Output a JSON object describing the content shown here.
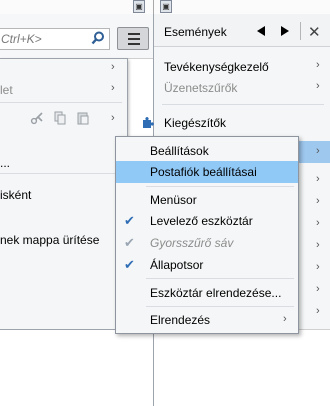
{
  "search": {
    "placeholder": "Ctrl+K>"
  },
  "right_pane": {
    "title": "Események",
    "items": [
      {
        "label": "Tevékenységkezelő",
        "dim": false
      },
      {
        "label": "Üzenetszűrők",
        "dim": true
      },
      {
        "label": "Kiegészítők",
        "dim": false
      }
    ]
  },
  "left_menu": {
    "items": [
      {
        "label": "let",
        "dim": true
      },
      {
        "label": "...",
        "dim": false
      },
      {
        "label": "isként",
        "dim": false
      },
      {
        "label": "nek mappa ürítése",
        "dim": false
      }
    ]
  },
  "submenu": {
    "items": [
      {
        "label": "Beállítások",
        "checked": false,
        "dim": false,
        "highlight": false,
        "arrow": false
      },
      {
        "label": "Postafiók beállításai",
        "checked": false,
        "dim": false,
        "highlight": true,
        "arrow": false
      },
      {
        "label": "Menüsor",
        "checked": false,
        "dim": false,
        "highlight": false,
        "arrow": false
      },
      {
        "label": "Levelező eszköztár",
        "checked": true,
        "dim": false,
        "highlight": false,
        "arrow": false
      },
      {
        "label": "Gyorsszűrő sáv",
        "checked": true,
        "dim": true,
        "highlight": false,
        "arrow": false
      },
      {
        "label": "Állapotsor",
        "checked": true,
        "dim": false,
        "highlight": false,
        "arrow": false
      },
      {
        "label": "Eszköztár elrendezése...",
        "checked": false,
        "dim": false,
        "highlight": false,
        "arrow": false
      },
      {
        "label": "Elrendezés",
        "checked": false,
        "dim": false,
        "highlight": false,
        "arrow": true
      }
    ]
  },
  "colors": {
    "highlight": "#90c8f6",
    "check": "#2f6db5",
    "menu_bg": "#f5f6f7"
  }
}
